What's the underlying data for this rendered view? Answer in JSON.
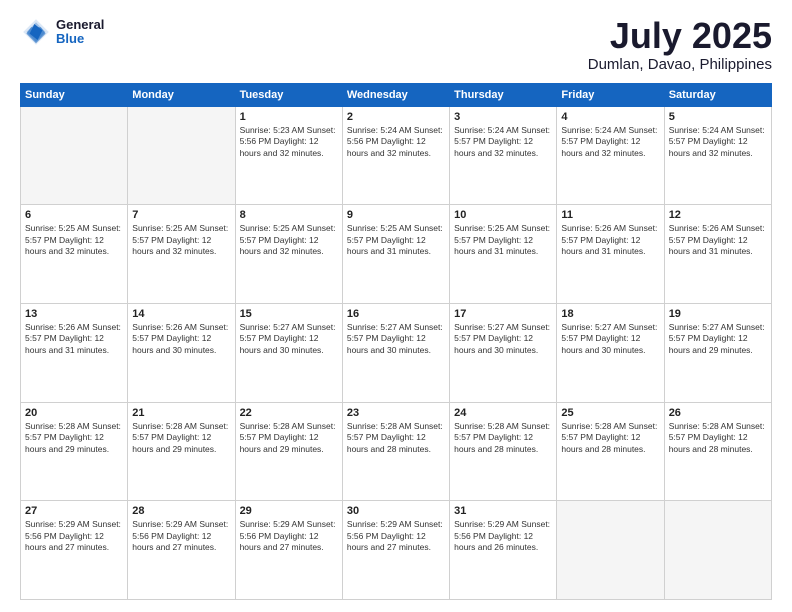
{
  "header": {
    "logo_general": "General",
    "logo_blue": "Blue",
    "title": "July 2025",
    "subtitle": "Dumlan, Davao, Philippines"
  },
  "days_of_week": [
    "Sunday",
    "Monday",
    "Tuesday",
    "Wednesday",
    "Thursday",
    "Friday",
    "Saturday"
  ],
  "weeks": [
    [
      {
        "day": "",
        "info": ""
      },
      {
        "day": "",
        "info": ""
      },
      {
        "day": "1",
        "info": "Sunrise: 5:23 AM\nSunset: 5:56 PM\nDaylight: 12 hours\nand 32 minutes."
      },
      {
        "day": "2",
        "info": "Sunrise: 5:24 AM\nSunset: 5:56 PM\nDaylight: 12 hours\nand 32 minutes."
      },
      {
        "day": "3",
        "info": "Sunrise: 5:24 AM\nSunset: 5:57 PM\nDaylight: 12 hours\nand 32 minutes."
      },
      {
        "day": "4",
        "info": "Sunrise: 5:24 AM\nSunset: 5:57 PM\nDaylight: 12 hours\nand 32 minutes."
      },
      {
        "day": "5",
        "info": "Sunrise: 5:24 AM\nSunset: 5:57 PM\nDaylight: 12 hours\nand 32 minutes."
      }
    ],
    [
      {
        "day": "6",
        "info": "Sunrise: 5:25 AM\nSunset: 5:57 PM\nDaylight: 12 hours\nand 32 minutes."
      },
      {
        "day": "7",
        "info": "Sunrise: 5:25 AM\nSunset: 5:57 PM\nDaylight: 12 hours\nand 32 minutes."
      },
      {
        "day": "8",
        "info": "Sunrise: 5:25 AM\nSunset: 5:57 PM\nDaylight: 12 hours\nand 32 minutes."
      },
      {
        "day": "9",
        "info": "Sunrise: 5:25 AM\nSunset: 5:57 PM\nDaylight: 12 hours\nand 31 minutes."
      },
      {
        "day": "10",
        "info": "Sunrise: 5:25 AM\nSunset: 5:57 PM\nDaylight: 12 hours\nand 31 minutes."
      },
      {
        "day": "11",
        "info": "Sunrise: 5:26 AM\nSunset: 5:57 PM\nDaylight: 12 hours\nand 31 minutes."
      },
      {
        "day": "12",
        "info": "Sunrise: 5:26 AM\nSunset: 5:57 PM\nDaylight: 12 hours\nand 31 minutes."
      }
    ],
    [
      {
        "day": "13",
        "info": "Sunrise: 5:26 AM\nSunset: 5:57 PM\nDaylight: 12 hours\nand 31 minutes."
      },
      {
        "day": "14",
        "info": "Sunrise: 5:26 AM\nSunset: 5:57 PM\nDaylight: 12 hours\nand 30 minutes."
      },
      {
        "day": "15",
        "info": "Sunrise: 5:27 AM\nSunset: 5:57 PM\nDaylight: 12 hours\nand 30 minutes."
      },
      {
        "day": "16",
        "info": "Sunrise: 5:27 AM\nSunset: 5:57 PM\nDaylight: 12 hours\nand 30 minutes."
      },
      {
        "day": "17",
        "info": "Sunrise: 5:27 AM\nSunset: 5:57 PM\nDaylight: 12 hours\nand 30 minutes."
      },
      {
        "day": "18",
        "info": "Sunrise: 5:27 AM\nSunset: 5:57 PM\nDaylight: 12 hours\nand 30 minutes."
      },
      {
        "day": "19",
        "info": "Sunrise: 5:27 AM\nSunset: 5:57 PM\nDaylight: 12 hours\nand 29 minutes."
      }
    ],
    [
      {
        "day": "20",
        "info": "Sunrise: 5:28 AM\nSunset: 5:57 PM\nDaylight: 12 hours\nand 29 minutes."
      },
      {
        "day": "21",
        "info": "Sunrise: 5:28 AM\nSunset: 5:57 PM\nDaylight: 12 hours\nand 29 minutes."
      },
      {
        "day": "22",
        "info": "Sunrise: 5:28 AM\nSunset: 5:57 PM\nDaylight: 12 hours\nand 29 minutes."
      },
      {
        "day": "23",
        "info": "Sunrise: 5:28 AM\nSunset: 5:57 PM\nDaylight: 12 hours\nand 28 minutes."
      },
      {
        "day": "24",
        "info": "Sunrise: 5:28 AM\nSunset: 5:57 PM\nDaylight: 12 hours\nand 28 minutes."
      },
      {
        "day": "25",
        "info": "Sunrise: 5:28 AM\nSunset: 5:57 PM\nDaylight: 12 hours\nand 28 minutes."
      },
      {
        "day": "26",
        "info": "Sunrise: 5:28 AM\nSunset: 5:57 PM\nDaylight: 12 hours\nand 28 minutes."
      }
    ],
    [
      {
        "day": "27",
        "info": "Sunrise: 5:29 AM\nSunset: 5:56 PM\nDaylight: 12 hours\nand 27 minutes."
      },
      {
        "day": "28",
        "info": "Sunrise: 5:29 AM\nSunset: 5:56 PM\nDaylight: 12 hours\nand 27 minutes."
      },
      {
        "day": "29",
        "info": "Sunrise: 5:29 AM\nSunset: 5:56 PM\nDaylight: 12 hours\nand 27 minutes."
      },
      {
        "day": "30",
        "info": "Sunrise: 5:29 AM\nSunset: 5:56 PM\nDaylight: 12 hours\nand 27 minutes."
      },
      {
        "day": "31",
        "info": "Sunrise: 5:29 AM\nSunset: 5:56 PM\nDaylight: 12 hours\nand 26 minutes."
      },
      {
        "day": "",
        "info": ""
      },
      {
        "day": "",
        "info": ""
      }
    ]
  ]
}
